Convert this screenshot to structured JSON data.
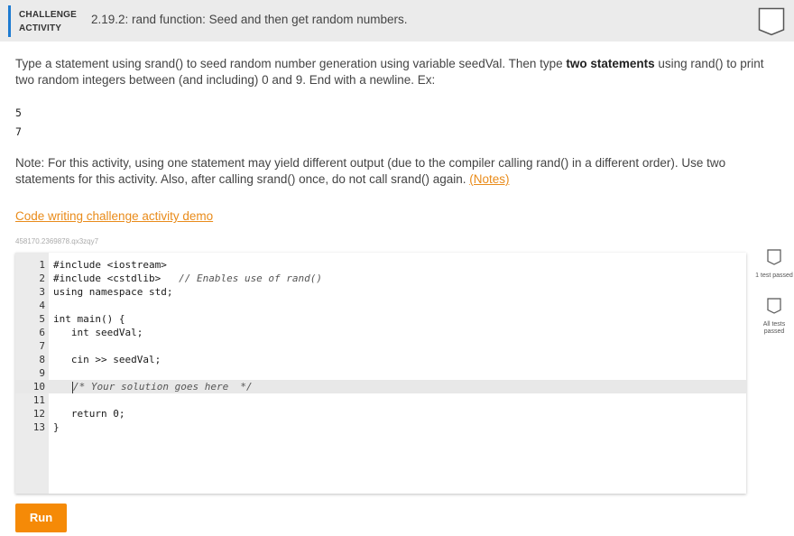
{
  "header": {
    "activity_type_line1": "CHALLENGE",
    "activity_type_line2": "ACTIVITY",
    "title": "2.19.2: rand function: Seed and then get random numbers."
  },
  "instructions": {
    "part1": "Type a statement using srand() to seed random number generation using variable seedVal. Then type ",
    "bold": "two statements",
    "part2": " using rand() to print two random integers between (and including) 0 and 9. End with a newline. Ex:",
    "example_output": [
      "5",
      "7"
    ],
    "note": "Note: For this activity, using one statement may yield different output (due to the compiler calling rand() in a different order). Use two statements for this activity. Also, after calling srand() once, do not call srand() again. ",
    "notes_link": "(Notes)"
  },
  "demo_link": "Code writing challenge activity demo",
  "reference_id": "458170.2369878.qx3zqy7",
  "editor": {
    "lines": [
      {
        "num": "1",
        "text": "#include <iostream>"
      },
      {
        "num": "2",
        "text": "#include <cstdlib>",
        "comment": "// Enables use of rand()"
      },
      {
        "num": "3",
        "text": "using namespace std;"
      },
      {
        "num": "4",
        "text": ""
      },
      {
        "num": "5",
        "text": "int main() {"
      },
      {
        "num": "6",
        "text": "   int seedVal;"
      },
      {
        "num": "7",
        "text": ""
      },
      {
        "num": "8",
        "text": "   cin >> seedVal;"
      },
      {
        "num": "9",
        "text": ""
      },
      {
        "num": "10",
        "text": "/* Your solution goes here  */"
      },
      {
        "num": "11",
        "text": ""
      },
      {
        "num": "12",
        "text": "   return 0;"
      },
      {
        "num": "13",
        "text": "}"
      }
    ],
    "active_line": 10
  },
  "results": {
    "test1_label": "1 test passed",
    "test2_label": "All tests passed"
  },
  "run_button": "Run",
  "colors": {
    "accent_blue": "#1e7bd1",
    "link_orange": "#e98b1a",
    "run_orange": "#f58a07",
    "header_bg": "#ebebeb"
  }
}
